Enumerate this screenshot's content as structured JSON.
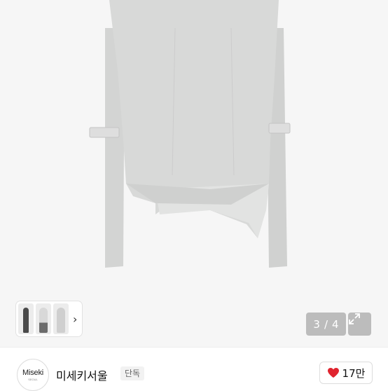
{
  "product": {
    "image_name": "light gray asymmetric long-sleeve top",
    "thumbnail_count": 3,
    "pager": {
      "current": "3",
      "separator": "/",
      "total": "4"
    },
    "expand_icon": "expand-arrows-icon",
    "thumb_next_icon": "chevron-right-icon"
  },
  "brand": {
    "logo_text": "Miseki",
    "logo_subtext": "SEOUL",
    "name": "미세키서울",
    "badge": "단독"
  },
  "like": {
    "icon": "heart-icon",
    "icon_color": "#e0242f",
    "count": "17만"
  }
}
